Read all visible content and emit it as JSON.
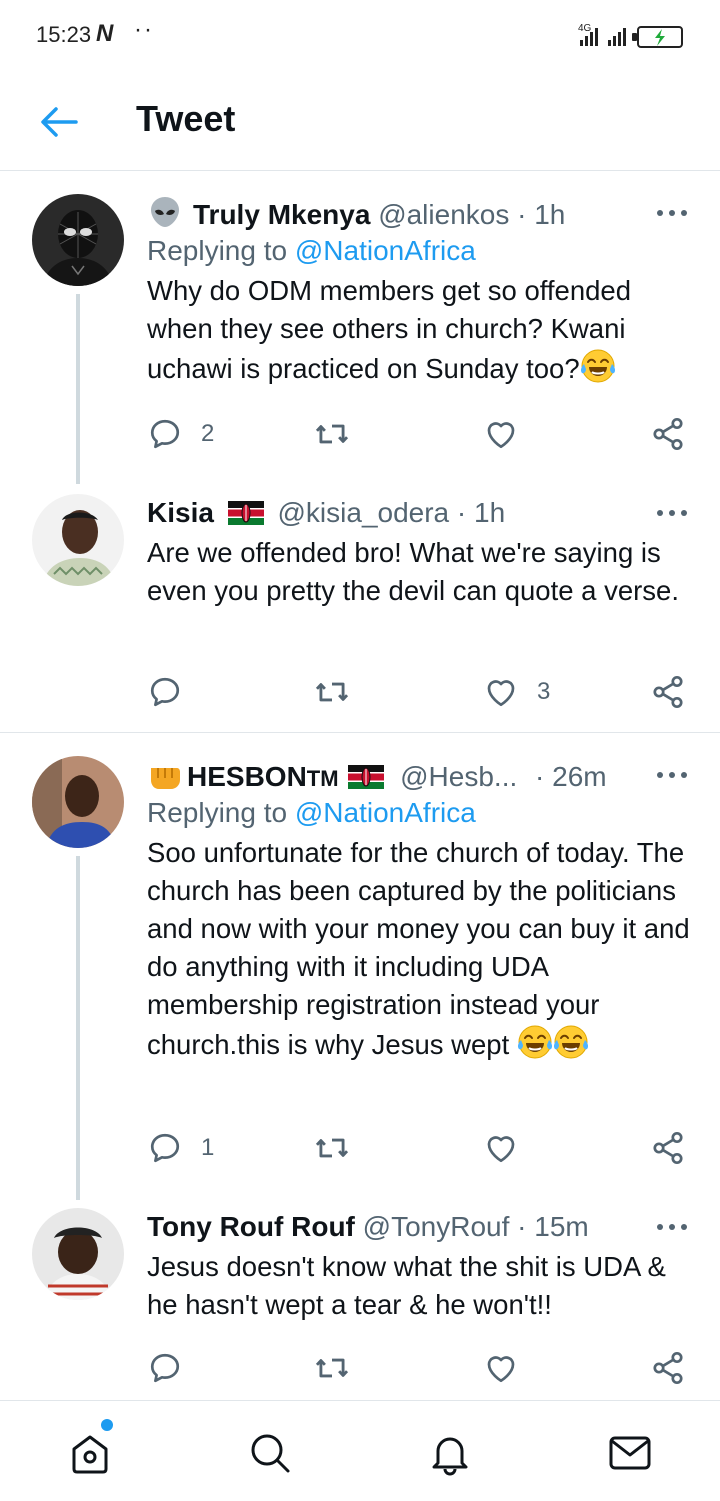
{
  "status_bar": {
    "time": "15:23",
    "app_badge": "N",
    "dots": "··",
    "network": "4G"
  },
  "header": {
    "title": "Tweet"
  },
  "tweets": [
    {
      "name": "Truly Mkenya",
      "handle": "@alienkos",
      "time": "· 1h",
      "replying_prefix": "Replying to ",
      "replying_to": "@NationAfrica",
      "text": "Why do ODM members get so offended when they see others in church? Kwani uchawi is practiced on Sunday too?",
      "reply_count": "2",
      "retweet_count": "",
      "like_count": ""
    },
    {
      "name": "Kisia",
      "handle": "@kisia_odera",
      "time": "· 1h",
      "text": "Are we offended bro! What we're saying is even you pretty the devil can quote a verse.",
      "reply_count": "",
      "retweet_count": "",
      "like_count": "3"
    },
    {
      "name": "HESBON",
      "name_suffix": "TM",
      "handle": "@Hesb...",
      "time": "· 26m",
      "replying_prefix": "Replying to ",
      "replying_to": "@NationAfrica",
      "text": "Soo unfortunate for the church of today. The church has been captured by the politicians and now with your money you can buy it and do anything with it including UDA membership registration instead your church.this is why Jesus wept",
      "reply_count": "1",
      "retweet_count": "",
      "like_count": ""
    },
    {
      "name": "Tony Rouf Rouf",
      "handle": "@TonyRouf",
      "time": "· 15m",
      "text": "Jesus doesn't know what the shit is UDA & he hasn't wept a tear & he won't!!",
      "reply_count": "",
      "retweet_count": "",
      "like_count": ""
    }
  ],
  "colors": {
    "accent": "#1d9bf0",
    "muted": "#536471",
    "text": "#0f1419",
    "line": "#cfd9de"
  },
  "icons": [
    "back-arrow-icon",
    "more-icon",
    "reply-icon",
    "retweet-icon",
    "like-icon",
    "share-icon",
    "home-icon",
    "search-icon",
    "notifications-icon",
    "messages-icon",
    "alien-icon",
    "fist-icon",
    "kenya-flag-icon",
    "laughing-crying-emoji"
  ]
}
